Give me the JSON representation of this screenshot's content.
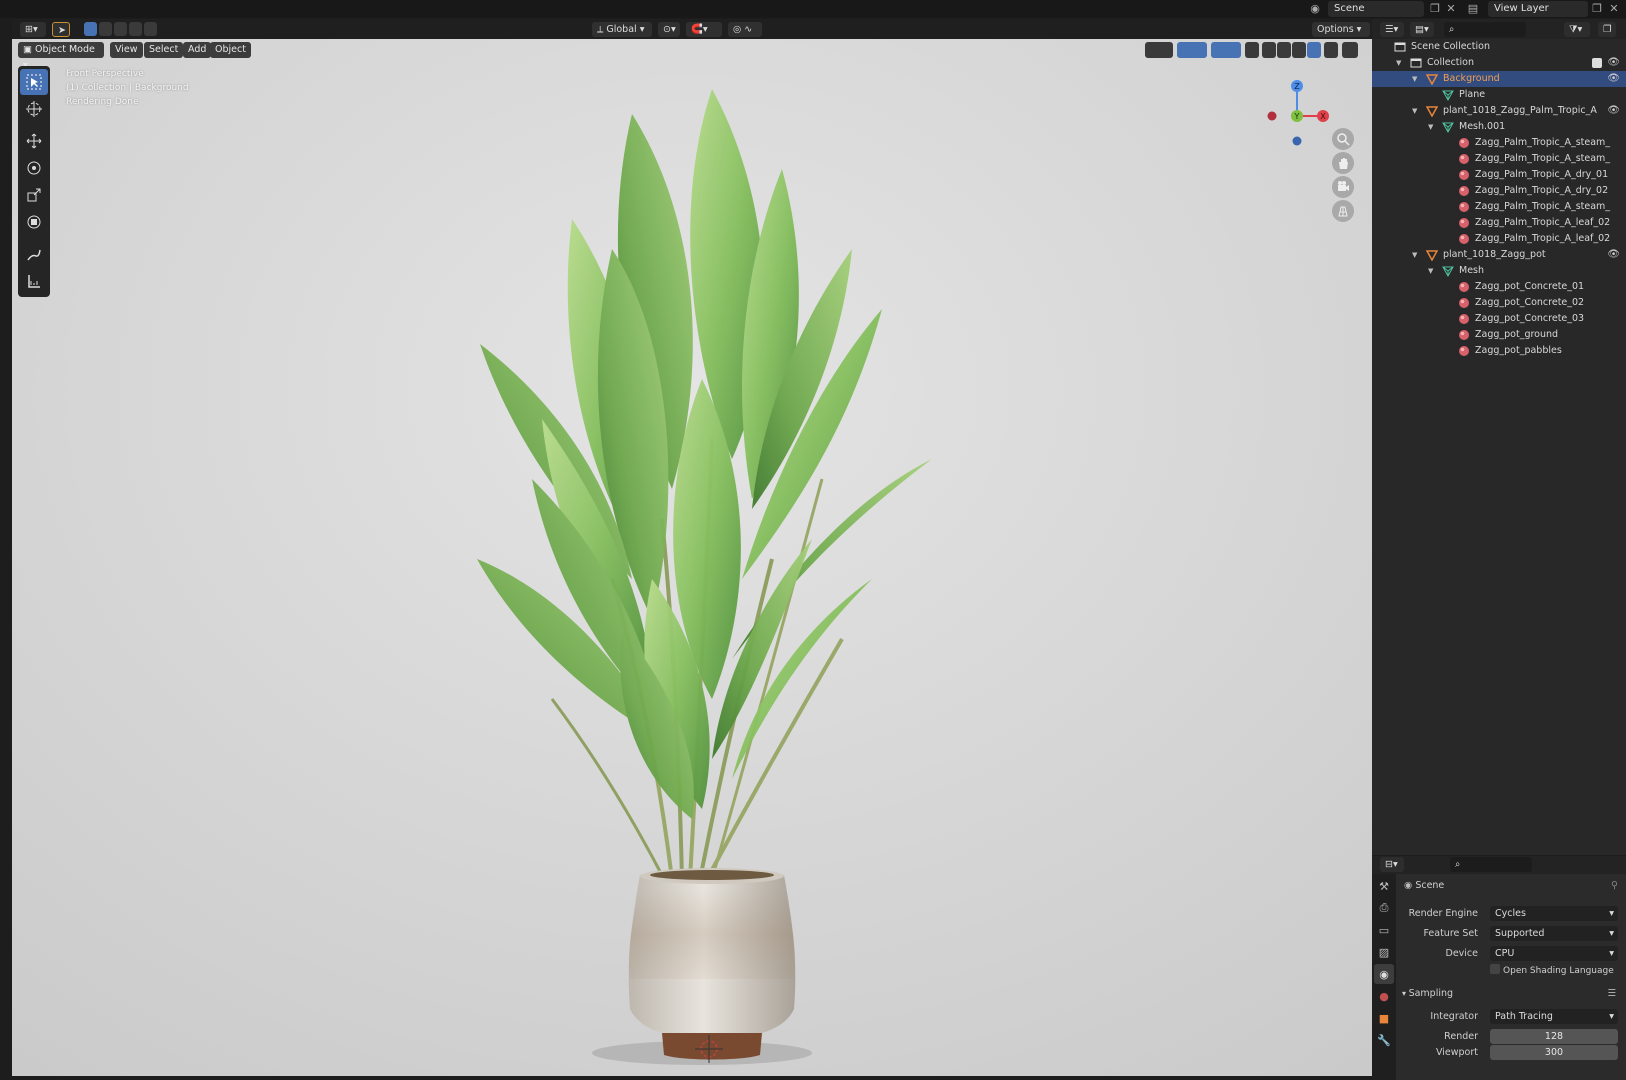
{
  "topbar": {
    "scene": "Scene",
    "view_layer": "View Layer"
  },
  "viewport": {
    "mode": "Object Mode",
    "menus": [
      "View",
      "Select",
      "Add",
      "Object"
    ],
    "orientation": "Global",
    "options": "Options",
    "overlay": [
      "Front Perspective",
      "(1) Collection | Background",
      "Rendering Done"
    ],
    "gizmo_axes": {
      "z": "Z",
      "y": "Y",
      "x": "X"
    }
  },
  "outliner": {
    "rows": [
      {
        "label": "Scene Collection",
        "type": "collection",
        "depth": 0,
        "arrow": false,
        "eye": false,
        "selected": false
      },
      {
        "label": "Collection",
        "type": "collection",
        "depth": 1,
        "arrow": true,
        "eye": true,
        "selected": false
      },
      {
        "label": "Background",
        "type": "object",
        "depth": 2,
        "arrow": true,
        "eye": true,
        "selected": true
      },
      {
        "label": "Plane",
        "type": "mesh",
        "depth": 3,
        "arrow": false,
        "eye": false,
        "selected": false
      },
      {
        "label": "plant_1018_Zagg_Palm_Tropic_A",
        "type": "object",
        "depth": 2,
        "arrow": true,
        "eye": true,
        "selected": false
      },
      {
        "label": "Mesh.001",
        "type": "mesh",
        "depth": 3,
        "arrow": true,
        "eye": false,
        "selected": false
      },
      {
        "label": "Zagg_Palm_Tropic_A_steam_",
        "type": "material",
        "depth": 4,
        "arrow": false,
        "eye": false,
        "selected": false
      },
      {
        "label": "Zagg_Palm_Tropic_A_steam_",
        "type": "material",
        "depth": 4,
        "arrow": false,
        "eye": false,
        "selected": false
      },
      {
        "label": "Zagg_Palm_Tropic_A_dry_01",
        "type": "material",
        "depth": 4,
        "arrow": false,
        "eye": false,
        "selected": false
      },
      {
        "label": "Zagg_Palm_Tropic_A_dry_02",
        "type": "material",
        "depth": 4,
        "arrow": false,
        "eye": false,
        "selected": false
      },
      {
        "label": "Zagg_Palm_Tropic_A_steam_",
        "type": "material",
        "depth": 4,
        "arrow": false,
        "eye": false,
        "selected": false
      },
      {
        "label": "Zagg_Palm_Tropic_A_leaf_02",
        "type": "material",
        "depth": 4,
        "arrow": false,
        "eye": false,
        "selected": false
      },
      {
        "label": "Zagg_Palm_Tropic_A_leaf_02",
        "type": "material",
        "depth": 4,
        "arrow": false,
        "eye": false,
        "selected": false
      },
      {
        "label": "plant_1018_Zagg_pot",
        "type": "object",
        "depth": 2,
        "arrow": true,
        "eye": true,
        "selected": false
      },
      {
        "label": "Mesh",
        "type": "mesh",
        "depth": 3,
        "arrow": true,
        "eye": false,
        "selected": false
      },
      {
        "label": "Zagg_pot_Concrete_01",
        "type": "material",
        "depth": 4,
        "arrow": false,
        "eye": false,
        "selected": false
      },
      {
        "label": "Zagg_pot_Concrete_02",
        "type": "material",
        "depth": 4,
        "arrow": false,
        "eye": false,
        "selected": false
      },
      {
        "label": "Zagg_pot_Concrete_03",
        "type": "material",
        "depth": 4,
        "arrow": false,
        "eye": false,
        "selected": false
      },
      {
        "label": "Zagg_pot_ground",
        "type": "material",
        "depth": 4,
        "arrow": false,
        "eye": false,
        "selected": false
      },
      {
        "label": "Zagg_pot_pabbles",
        "type": "material",
        "depth": 4,
        "arrow": false,
        "eye": false,
        "selected": false
      }
    ]
  },
  "properties": {
    "context": "Scene",
    "render_engine_label": "Render Engine",
    "render_engine": "Cycles",
    "feature_set_label": "Feature Set",
    "feature_set": "Supported",
    "device_label": "Device",
    "device": "CPU",
    "osl_label": "Open Shading Language",
    "sampling_label": "Sampling",
    "integrator_label": "Integrator",
    "integrator": "Path Tracing",
    "render_label": "Render",
    "render_samples": "128",
    "viewport_label": "Viewport",
    "viewport_samples": "300"
  },
  "colors": {
    "accent": "#4772b3",
    "selected_row": "#334c80",
    "object_orange": "#e8853a",
    "mesh_green": "#4fc0a0",
    "material_red": "#d8606a",
    "viewport_bg": "#d8d8d8"
  }
}
